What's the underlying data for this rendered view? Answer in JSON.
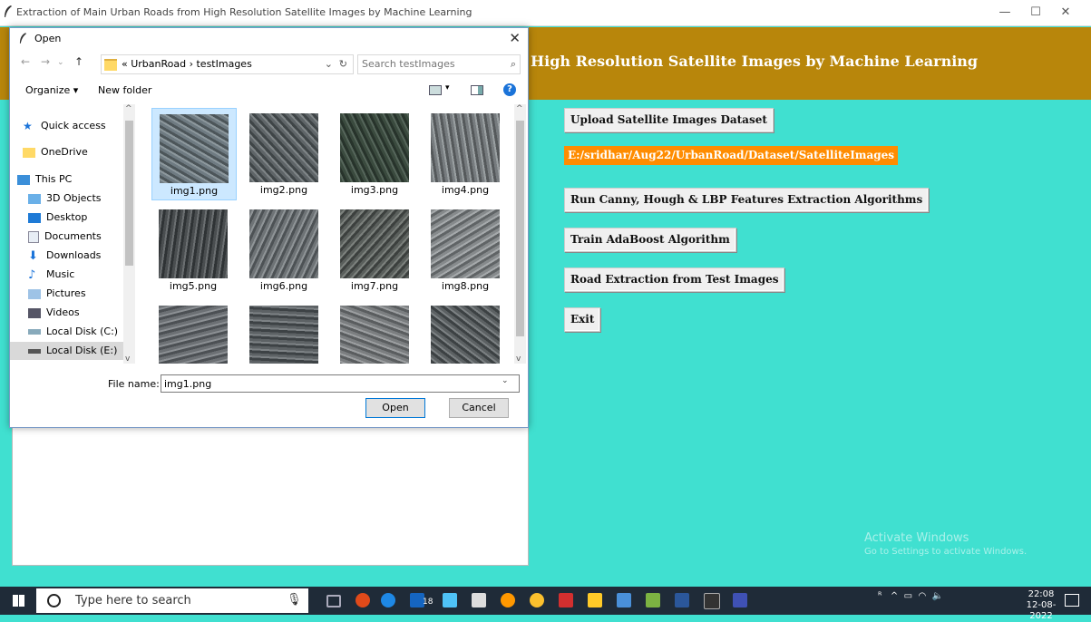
{
  "window": {
    "title": "Extraction of Main Urban Roads from High Resolution Satellite Images by Machine Learning",
    "minimize": "—",
    "maximize": "☐",
    "close": "✕"
  },
  "header": {
    "title": "High Resolution Satellite Images by Machine Learning",
    "color": "#B8860B"
  },
  "app": {
    "background": "#40E0D0",
    "buttons": [
      "Upload Satellite Images Dataset",
      "Run Canny, Hough & LBP Features Extraction Algorithms",
      "Train AdaBoost Algorithm",
      "Road Extraction from Test Images",
      "Exit"
    ],
    "dataset_path": "E:/sridhar/Aug22/UrbanRoad/Dataset/SatelliteImages"
  },
  "dialog": {
    "title": "Open",
    "breadcrumb": "« UrbanRoad › testImages",
    "search_placeholder": "Search testImages",
    "organize": "Organize ▾",
    "new_folder": "New folder",
    "nav_items": [
      {
        "label": "Quick access",
        "icon": "star-icon"
      },
      {
        "label": "OneDrive",
        "icon": "folder-icon"
      },
      {
        "label": "This PC",
        "icon": "computer-icon"
      },
      {
        "label": "3D Objects",
        "icon": "cube-icon"
      },
      {
        "label": "Desktop",
        "icon": "desktop-icon"
      },
      {
        "label": "Documents",
        "icon": "document-icon"
      },
      {
        "label": "Downloads",
        "icon": "download-icon"
      },
      {
        "label": "Music",
        "icon": "music-icon"
      },
      {
        "label": "Pictures",
        "icon": "pictures-icon"
      },
      {
        "label": "Videos",
        "icon": "video-icon"
      },
      {
        "label": "Local Disk (C:)",
        "icon": "disk-icon"
      },
      {
        "label": "Local Disk (E:)",
        "icon": "disk-icon"
      }
    ],
    "files": [
      "img1.png",
      "img2.png",
      "img3.png",
      "img4.png",
      "img5.png",
      "img6.png",
      "img7.png",
      "img8.png",
      "",
      "",
      "",
      ""
    ],
    "selected_file": "img1.png",
    "file_name_label": "File name:",
    "file_name_value": "img1.png",
    "open_label": "Open",
    "cancel_label": "Cancel"
  },
  "watermark": {
    "title": "Activate Windows",
    "subtitle": "Go to Settings to activate Windows."
  },
  "taskbar": {
    "search_text": "Type here to search",
    "tray_badge": "18",
    "clock_time": "22:08",
    "clock_date": "12-08-2022"
  }
}
